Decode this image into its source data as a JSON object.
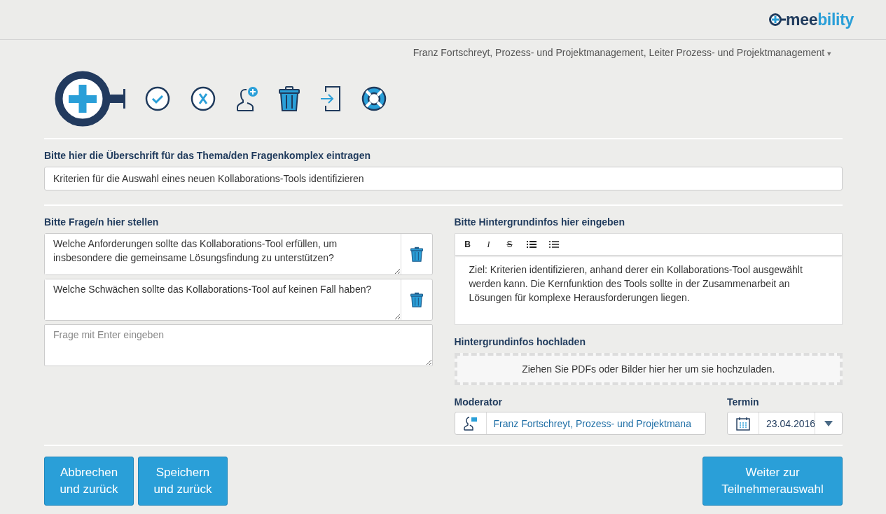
{
  "logo": {
    "parts": [
      "mee",
      "bility"
    ]
  },
  "user_menu": {
    "label": "Franz Fortschreyt, Prozess- und Projektmanagement, Leiter Prozess- und Projektmanagement",
    "caret": "▾"
  },
  "toolbar": [
    {
      "kind": "check"
    },
    {
      "kind": "cancel"
    },
    {
      "kind": "add-person"
    },
    {
      "kind": "trash"
    },
    {
      "kind": "exit"
    },
    {
      "kind": "help"
    }
  ],
  "title_field": {
    "label": "Bitte hier die Überschrift für das Thema/den Fragenkomplex eintragen",
    "value": "Kriterien für die Auswahl eines neuen Kollaborations-Tools identifizieren"
  },
  "questions": {
    "label": "Bitte Frage/n hier stellen",
    "items": [
      "Welche Anforderungen sollte das Kollaborations-Tool erfüllen, um insbesondere die gemeinsame Lösungsfindung zu unterstützen?",
      "Welche Schwächen sollte das Kollaborations-Tool auf keinen Fall haben?"
    ],
    "new_placeholder": "Frage mit Enter eingeben"
  },
  "background": {
    "label": "Bitte Hintergrundinfos hier eingeben",
    "format_buttons": [
      {
        "kind": "bold",
        "text": "B"
      },
      {
        "kind": "italic",
        "text": "I"
      },
      {
        "kind": "strike",
        "text": "S"
      },
      {
        "kind": "bullets"
      },
      {
        "kind": "numbers"
      }
    ],
    "text": "Ziel: Kriterien identifizieren, anhand derer ein Kollaborations-Tool ausgewählt werden kann. Die Kernfunktion des Tools sollte in der Zusammenarbeit an Lösungen für komplexe Herausforderungen liegen."
  },
  "upload": {
    "label": "Hintergrundinfos hochladen",
    "hint": "Ziehen Sie PDFs oder Bilder hier her um sie hochzuladen."
  },
  "moderator": {
    "label": "Moderator",
    "value": "Franz Fortschreyt, Prozess- und Projektmana"
  },
  "termin": {
    "label": "Termin",
    "value": "23.04.2016"
  },
  "buttons": [
    {
      "label": "Abbrechen\nund zurück",
      "kind": "back"
    },
    {
      "label": "Speichern\nund zurück",
      "kind": "back"
    },
    {
      "label": "Weiter zur\nTeilnehmerauswahl",
      "kind": "forward"
    }
  ]
}
